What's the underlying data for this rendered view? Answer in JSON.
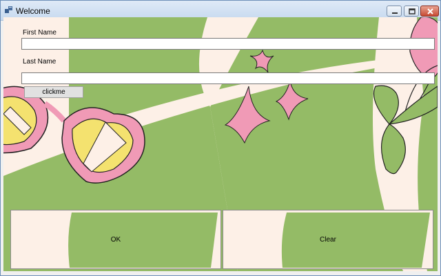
{
  "window": {
    "title": "Welcome",
    "icon": "app-window-icon",
    "controls": [
      "minimize-icon",
      "maximize-icon",
      "close-icon"
    ]
  },
  "form": {
    "first_name_label": "First Name",
    "first_name_value": "",
    "last_name_label": "Last Name",
    "last_name_value": "",
    "clickme_label": "clickme",
    "ok_label": "OK",
    "clear_label": "Clear"
  },
  "colors": {
    "background_cream": "#fdf0e7",
    "background_green": "#94bb66",
    "accent_pink": "#f09ab6",
    "accent_yellow": "#f4e26f",
    "close_red": "#c74a33"
  }
}
